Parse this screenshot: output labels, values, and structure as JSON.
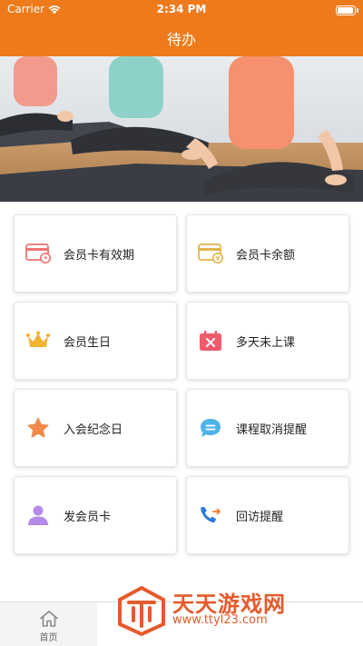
{
  "status_bar": {
    "carrier": "Carrier",
    "time": "2:34 PM",
    "battery_level": 1.0
  },
  "nav": {
    "title": "待办"
  },
  "colors": {
    "accent": "#ee7a1b"
  },
  "cards": [
    {
      "label": "会员卡有效期",
      "icon": "card-clock-icon"
    },
    {
      "label": "会员卡余额",
      "icon": "card-coin-icon"
    },
    {
      "label": "会员生日",
      "icon": "crown-icon"
    },
    {
      "label": "多天未上课",
      "icon": "calendar-x-icon"
    },
    {
      "label": "入会纪念日",
      "icon": "star-icon"
    },
    {
      "label": "课程取消提醒",
      "icon": "chat-bubble-icon"
    },
    {
      "label": "发会员卡",
      "icon": "person-icon"
    },
    {
      "label": "回访提醒",
      "icon": "phone-icon"
    }
  ],
  "tabbar": {
    "home_label": "首页"
  },
  "watermark": {
    "line1": "天天游戏网",
    "line2": "www.ttyl23.com"
  }
}
